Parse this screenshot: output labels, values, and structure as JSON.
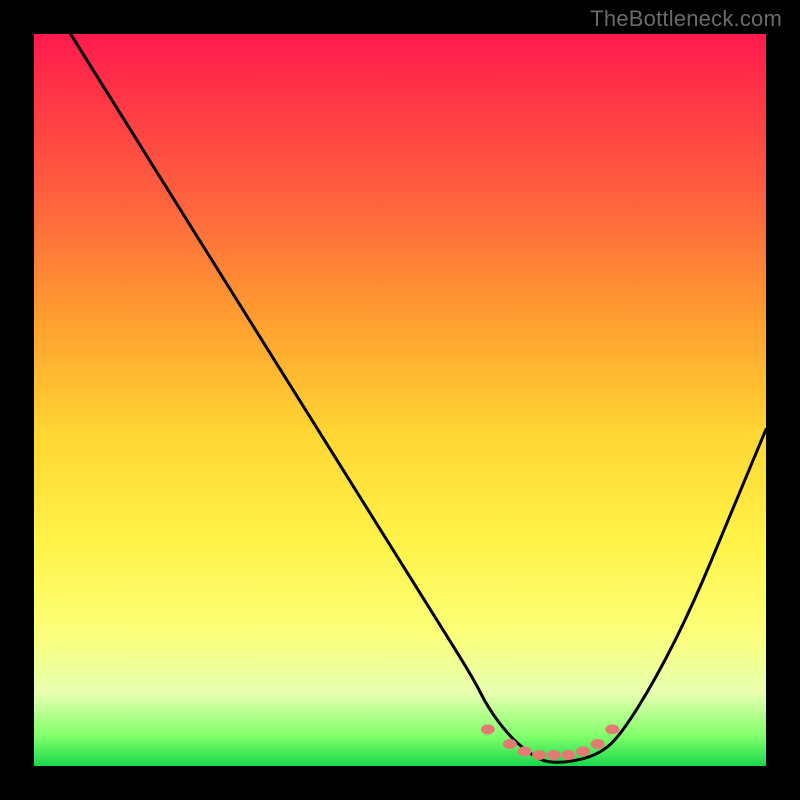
{
  "watermark": "TheBottleneck.com",
  "chart_data": {
    "type": "line",
    "title": "",
    "xlabel": "",
    "ylabel": "",
    "xlim": [
      0,
      100
    ],
    "ylim": [
      0,
      100
    ],
    "x": [
      5,
      10,
      15,
      20,
      25,
      30,
      35,
      40,
      45,
      50,
      55,
      60,
      62,
      65,
      68,
      70,
      73,
      77,
      80,
      85,
      90,
      95,
      100
    ],
    "values": [
      100,
      92,
      84,
      76,
      68,
      60,
      52,
      44,
      36,
      28,
      20,
      12,
      8,
      4,
      1.5,
      0.5,
      0.5,
      1.5,
      4,
      12,
      22,
      34,
      46
    ],
    "note": "x and y in percent of plot area; y=0 is bottom (green), y=100 is top (red). Curve is a bottleneck V with flat minimum around x≈68–75.",
    "markers": {
      "style": "salmon-dots",
      "x": [
        62,
        65,
        67,
        69,
        71,
        73,
        75,
        77,
        79
      ],
      "y": [
        5,
        3,
        2,
        1.5,
        1.5,
        1.5,
        2,
        3,
        5
      ]
    }
  }
}
